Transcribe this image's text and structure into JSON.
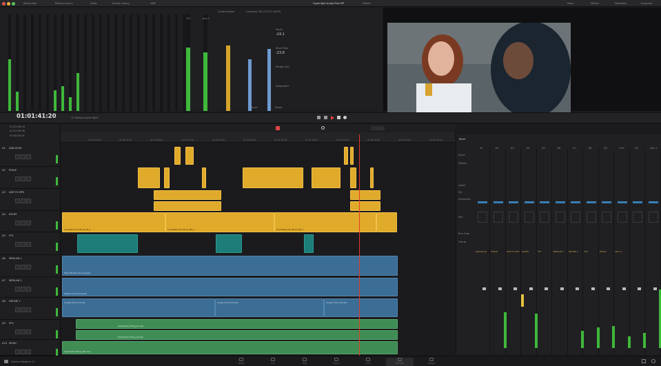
{
  "topbar": {
    "buttons": [
      "Media Pool",
      "Effects Library",
      "Index",
      "Sound Library",
      "ADR"
    ],
    "title": "Hyperlight Audio Post MP",
    "title_suffix": "Edited",
    "right": [
      "Mixer",
      "Meters",
      "Metadata",
      "Inspector"
    ]
  },
  "meters_panel": {
    "bus_labels": [
      "M1",
      "Bus 1"
    ],
    "control_room": "Control Room",
    "loudness": "Loudness",
    "loudness_mode": "BS.1770-1 (LUFS)",
    "short_label": "Short",
    "short_val": "-24.1",
    "short_max_label": "Short Max",
    "short_max_val": "-23.8",
    "range_label": "Range (LU)",
    "integrated_label": "Integrated",
    "pause": "Pause",
    "reset": "Reset"
  },
  "timeline": {
    "timecode": "01:01:41:20",
    "name": "12 Mixing Scene Start",
    "timecodes": [
      "01:01:04:19",
      "01:01:09:06",
      "00:00:00:01"
    ]
  },
  "tracks": [
    {
      "id": "A1",
      "name": "DIALOGUE"
    },
    {
      "id": "A2",
      "name": "PHILIP"
    },
    {
      "id": "A3",
      "name": "ADR FX MPS"
    },
    {
      "id": "A4",
      "name": "ROOM"
    },
    {
      "id": "A5",
      "name": "FFX"
    },
    {
      "id": "A6",
      "name": "MEDLAB 1"
    },
    {
      "id": "A7",
      "name": "MEDLAB 2"
    },
    {
      "id": "A8",
      "name": "DRONE 1"
    },
    {
      "id": "A9",
      "name": "SFX"
    },
    {
      "id": "A10",
      "name": "MUSIC"
    }
  ],
  "ruler": [
    "01:01:00:00",
    "01:01:04:00",
    "01:01:08:00",
    "01:01:12:00",
    "01:01:16:00",
    "01:01:20:00",
    "01:01:24:00",
    "01:01:28:00",
    "01:01:32:00",
    "01:01:36:00",
    "01:01:40:00",
    "01:01:44:00",
    "01:01:48:00"
  ],
  "clips": {
    "room1": "H_ambient_DS_04_12_Ro_1",
    "room2": "H_ambient_DS_06_12_RO_1",
    "room3": "H_ambient_DS_06_12_RO_1",
    "medlab1": "Heart Monitor Sci Long.wav",
    "medlab2": "Telephone Fill Long.wav",
    "drone1": "Longer Drone 2.0.wav",
    "drone2": "Longer Drone 2.0.wav",
    "drone3": "Longer Drone 2.0.wav",
    "sfx1": "Hyperlight_Ending_01.wav",
    "sfx2": "Hyperlight_Ending_02.wav",
    "music": "Hyperlight_Ending_Mix.wav"
  },
  "mixer": {
    "title": "Mixer",
    "channels": [
      "A1",
      "A2",
      "A3",
      "A4",
      "A5",
      "A6",
      "A7",
      "A8",
      "A9",
      "A10",
      "M1",
      "Bus 1"
    ],
    "strip_names": [
      "DIALOGUE",
      "PHILIP",
      "ADR FX MPS",
      "ROOM",
      "FFX",
      "MEDLAB 1",
      "DRONE 1",
      "SFX",
      "MUSIC",
      "Main 1"
    ],
    "row_labels": [
      "Input",
      "Effects",
      "Insert",
      "EQ",
      "Dynamics",
      "Pan",
      "Bus Outs",
      "Group"
    ]
  },
  "pages": [
    "Media",
    "Cut",
    "Edit",
    "Fusion",
    "Color",
    "Fairlight",
    "Deliver"
  ],
  "app_name": "DaVinci Resolve 17",
  "colors": {
    "clip_gold": "#e0aa2a",
    "clip_teal": "#1d7d78",
    "clip_blue": "#3c6d95",
    "clip_green": "#3f8c55",
    "playhead": "#e8392b",
    "meter_green": "#3fb83b"
  }
}
